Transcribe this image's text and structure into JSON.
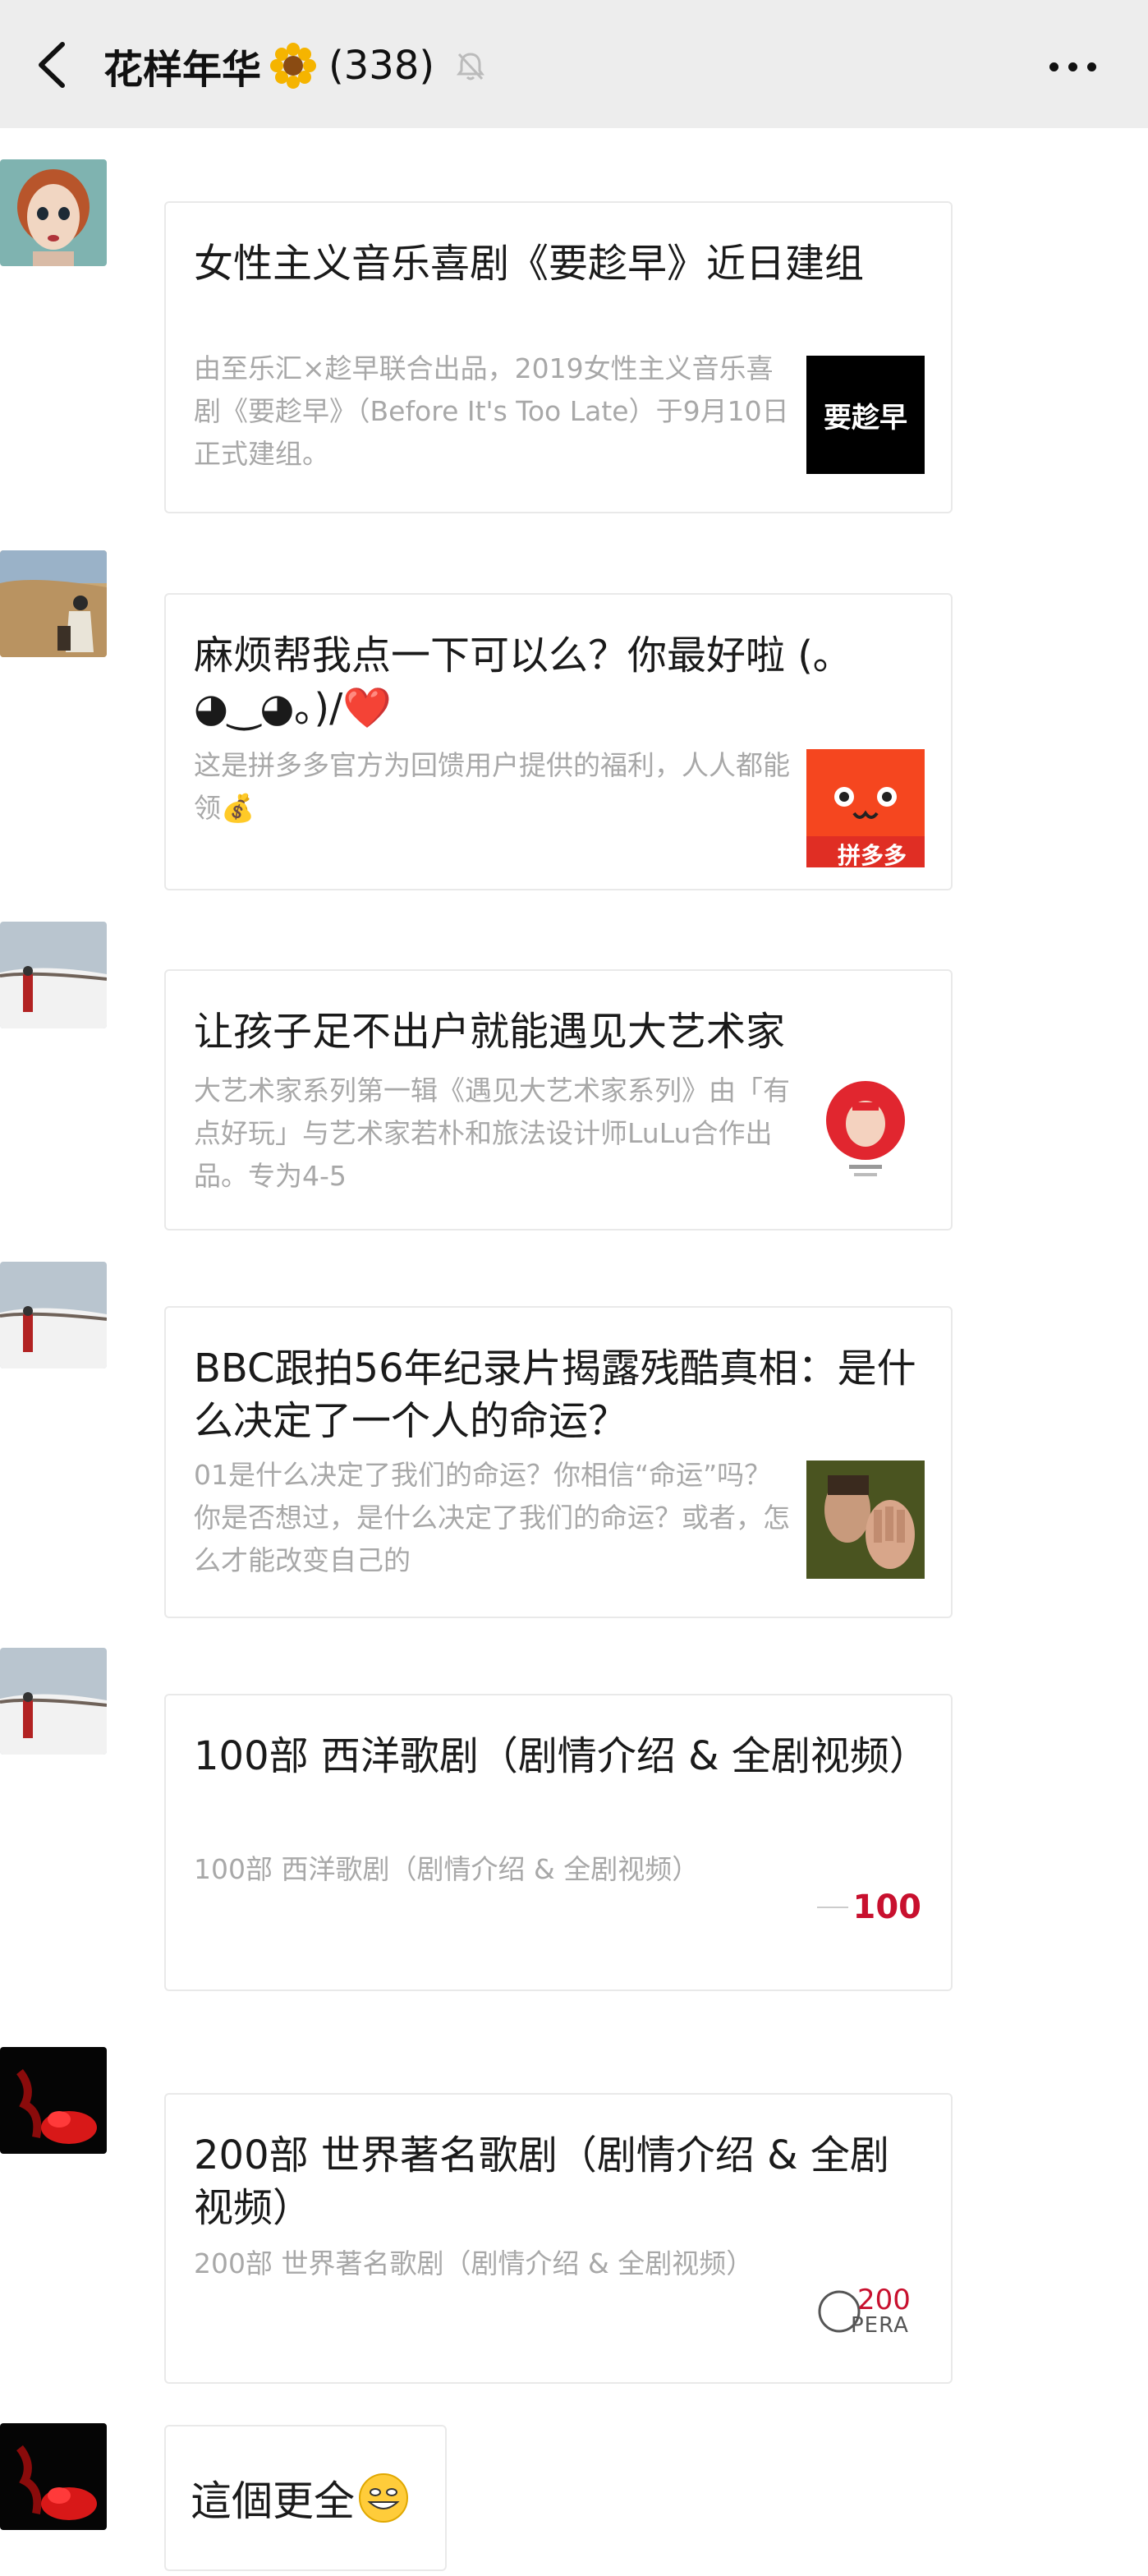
{
  "header": {
    "group_name": "花样年华",
    "member_count": "(338)",
    "title_emoji": "sunflower-icon",
    "muted_icon": "bell-slash-icon",
    "more_icon": "ellipsis-icon",
    "back_icon": "chevron-left-icon"
  },
  "messages": [
    {
      "title": "女性主义音乐喜剧《要趁早》近日建组",
      "desc": "由至乐汇×趁早联合出品，2019女性主义音乐喜剧《要趁早》（Before It's Too Late）于9月10日正式建组。",
      "thumb_text": "要趁早"
    },
    {
      "title": "麻烦帮我点一下可以么？你最好啦 (｡◕‿◕｡)/❤️",
      "desc": "这是拼多多官方为回馈用户提供的福利，人人都能领💰",
      "thumb_text": "拼多多"
    },
    {
      "title": "让孩子足不出户就能遇见大艺术家",
      "desc": "大艺术家系列第一辑《遇见大艺术家系列》由「有点好玩」与艺术家若朴和旅法设计师LuLu合作出品。专为4-5"
    },
    {
      "title": "BBC跟拍56年纪录片揭露残酷真相：是什么决定了一个人的命运？",
      "desc": "01是什么决定了我们的命运？你相信“命运”吗？你是否想过，是什么决定了我们的命运？或者，怎么才能改变自己的"
    },
    {
      "title": "100部 西洋歌剧（剧情介绍 & 全剧视频）",
      "desc": "100部 西洋歌剧（剧情介绍 & 全剧视频）",
      "thumb_text": "100"
    },
    {
      "title": "200部 世界著名歌剧（剧情介绍 & 全剧视频）",
      "desc": "200部 世界著名歌剧（剧情介绍 & 全剧视频）",
      "thumb_text": "200",
      "thumb_sub": "PERA"
    }
  ],
  "last_message": {
    "text": "這個更全",
    "emoji": "grinning-face-icon"
  },
  "colors": {
    "header_bg": "#ededed",
    "desc_gray": "#a8a8a8",
    "pdd_red": "#e02e24"
  }
}
